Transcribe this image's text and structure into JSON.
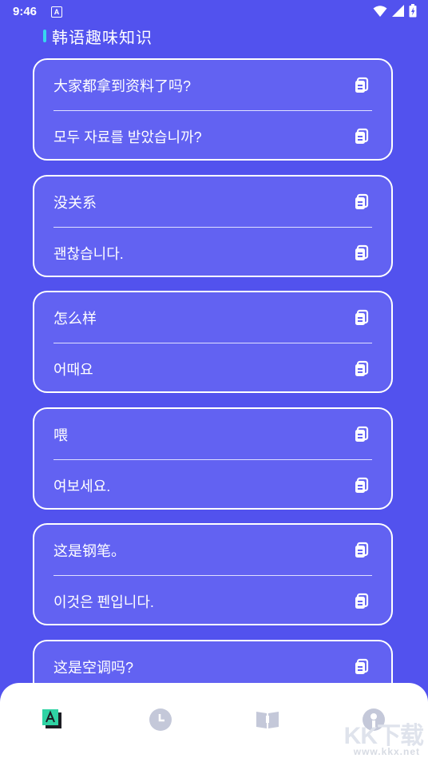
{
  "status_bar": {
    "time": "9:46",
    "app_icon_letter": "A",
    "icons": [
      "wifi-icon",
      "signal-icon",
      "battery-icon"
    ]
  },
  "header": {
    "title": "韩语趣味知识",
    "accent_color": "#36d6ee"
  },
  "cards": [
    {
      "chinese": "大家都拿到资料了吗?",
      "korean": "모두 자료를 받았습니까?"
    },
    {
      "chinese": "没关系",
      "korean": "괜찮습니다."
    },
    {
      "chinese": "怎么样",
      "korean": "어때요"
    },
    {
      "chinese": "喂",
      "korean": "여보세요."
    },
    {
      "chinese": "这是钢笔。",
      "korean": "이것은 펜입니다."
    },
    {
      "chinese": "这是空调吗?",
      "korean": ""
    }
  ],
  "bottom_nav": {
    "items": [
      {
        "name": "translate-icon",
        "active": true
      },
      {
        "name": "clock-icon",
        "active": false
      },
      {
        "name": "book-icon",
        "active": false
      },
      {
        "name": "profile-icon",
        "active": false
      }
    ]
  },
  "watermark": {
    "logo": "KK下载",
    "url": "www.kkx.net"
  },
  "colors": {
    "background": "#5252ee",
    "card": "#6262f2",
    "nav_inactive": "#c4c8d9",
    "nav_active": "#2fd3a4"
  }
}
